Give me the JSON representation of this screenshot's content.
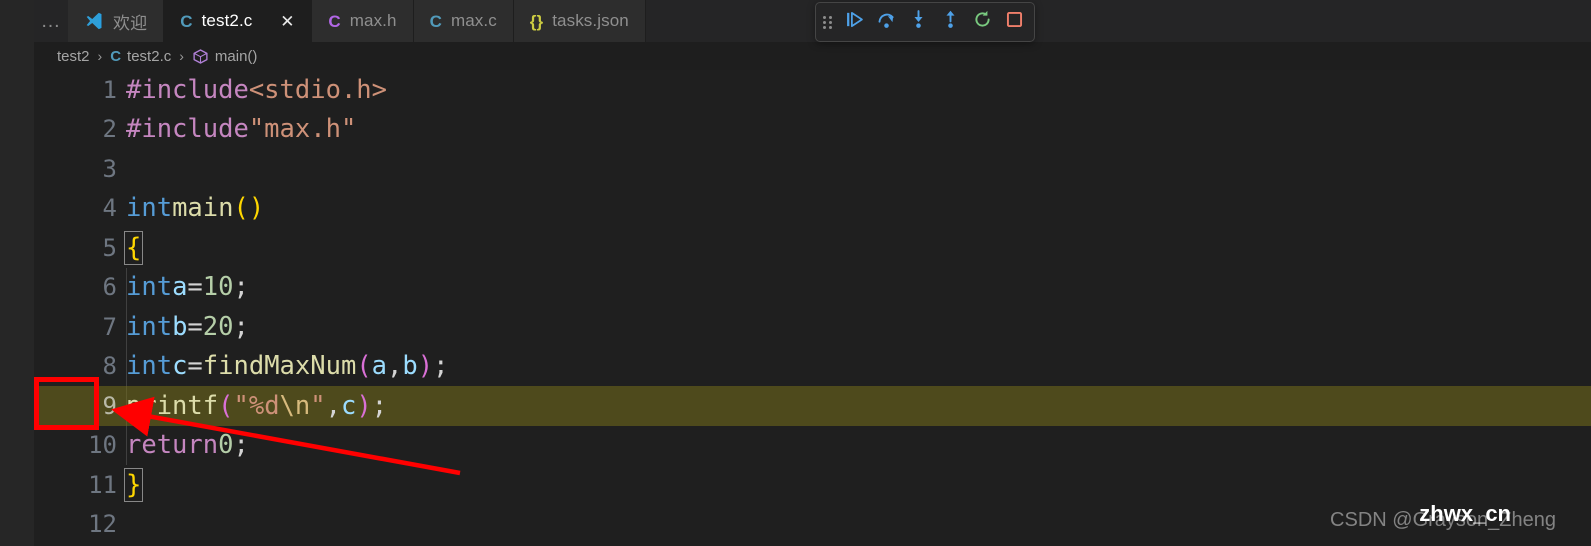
{
  "window": {
    "background": "#1e1e1e",
    "editor_background": "#1f1f1f"
  },
  "tabbar": {
    "overflow_label": "…",
    "tabs": [
      {
        "label": "欢迎",
        "icon": "vscode-logo-icon",
        "active": false,
        "closable": false
      },
      {
        "label": "test2.c",
        "icon": "c-file-icon",
        "icon_color": "#519aba",
        "active": true,
        "closable": true,
        "close_label": "✕"
      },
      {
        "label": "max.h",
        "icon": "c-header-file-icon",
        "icon_color": "#b267e6",
        "active": false,
        "closable": false
      },
      {
        "label": "max.c",
        "icon": "c-file-icon",
        "icon_color": "#519aba",
        "active": false,
        "closable": false
      },
      {
        "label": "tasks.json",
        "icon": "json-file-icon",
        "icon_color": "#cbcb41",
        "active": false,
        "closable": false
      }
    ]
  },
  "debug_toolbar": {
    "grip_label": "drag-handle",
    "buttons": [
      {
        "name": "continue",
        "tooltip": "Continue",
        "color": "#75beff"
      },
      {
        "name": "step-over",
        "tooltip": "Step Over",
        "color": "#75beff"
      },
      {
        "name": "step-into",
        "tooltip": "Step Into",
        "color": "#75beff"
      },
      {
        "name": "step-out",
        "tooltip": "Step Out",
        "color": "#75beff"
      },
      {
        "name": "restart",
        "tooltip": "Restart",
        "color": "#89d185"
      },
      {
        "name": "stop",
        "tooltip": "Stop",
        "color": "#f48771"
      }
    ]
  },
  "breadcrumb": {
    "separator": "›",
    "items": [
      {
        "label": "test2",
        "icon": null
      },
      {
        "label": "test2.c",
        "icon": "c-file-icon"
      },
      {
        "label": "main()",
        "icon": "symbol-method-icon"
      }
    ]
  },
  "editor": {
    "language": "c",
    "current_line": 9,
    "breakpoint_line": 8,
    "lines": [
      {
        "number": "1",
        "text": "#include <stdio.h>"
      },
      {
        "number": "2",
        "text": "#include \"max.h\""
      },
      {
        "number": "3",
        "text": ""
      },
      {
        "number": "4",
        "text": "int main()"
      },
      {
        "number": "5",
        "text": "{"
      },
      {
        "number": "6",
        "text": "    int a = 10;"
      },
      {
        "number": "7",
        "text": "    int b = 20;"
      },
      {
        "number": "8",
        "text": "    int c = findMaxNum(a, b);"
      },
      {
        "number": "9",
        "text": "    printf(\"%d\\n\", c);"
      },
      {
        "number": "10",
        "text": "    return 0;"
      },
      {
        "number": "11",
        "text": "}"
      },
      {
        "number": "12",
        "text": ""
      }
    ],
    "current_line_highlight_color": "#4e4a1c",
    "breakpoint_color": "#e51400",
    "debug_pointer_color": "#ffcc00"
  },
  "annotations": {
    "highlight_rect_color": "#ff0000",
    "arrow_color": "#ff0000"
  },
  "watermarks": {
    "csdn": "CSDN @Grayson_Zheng",
    "site": "zhwx_cn"
  }
}
